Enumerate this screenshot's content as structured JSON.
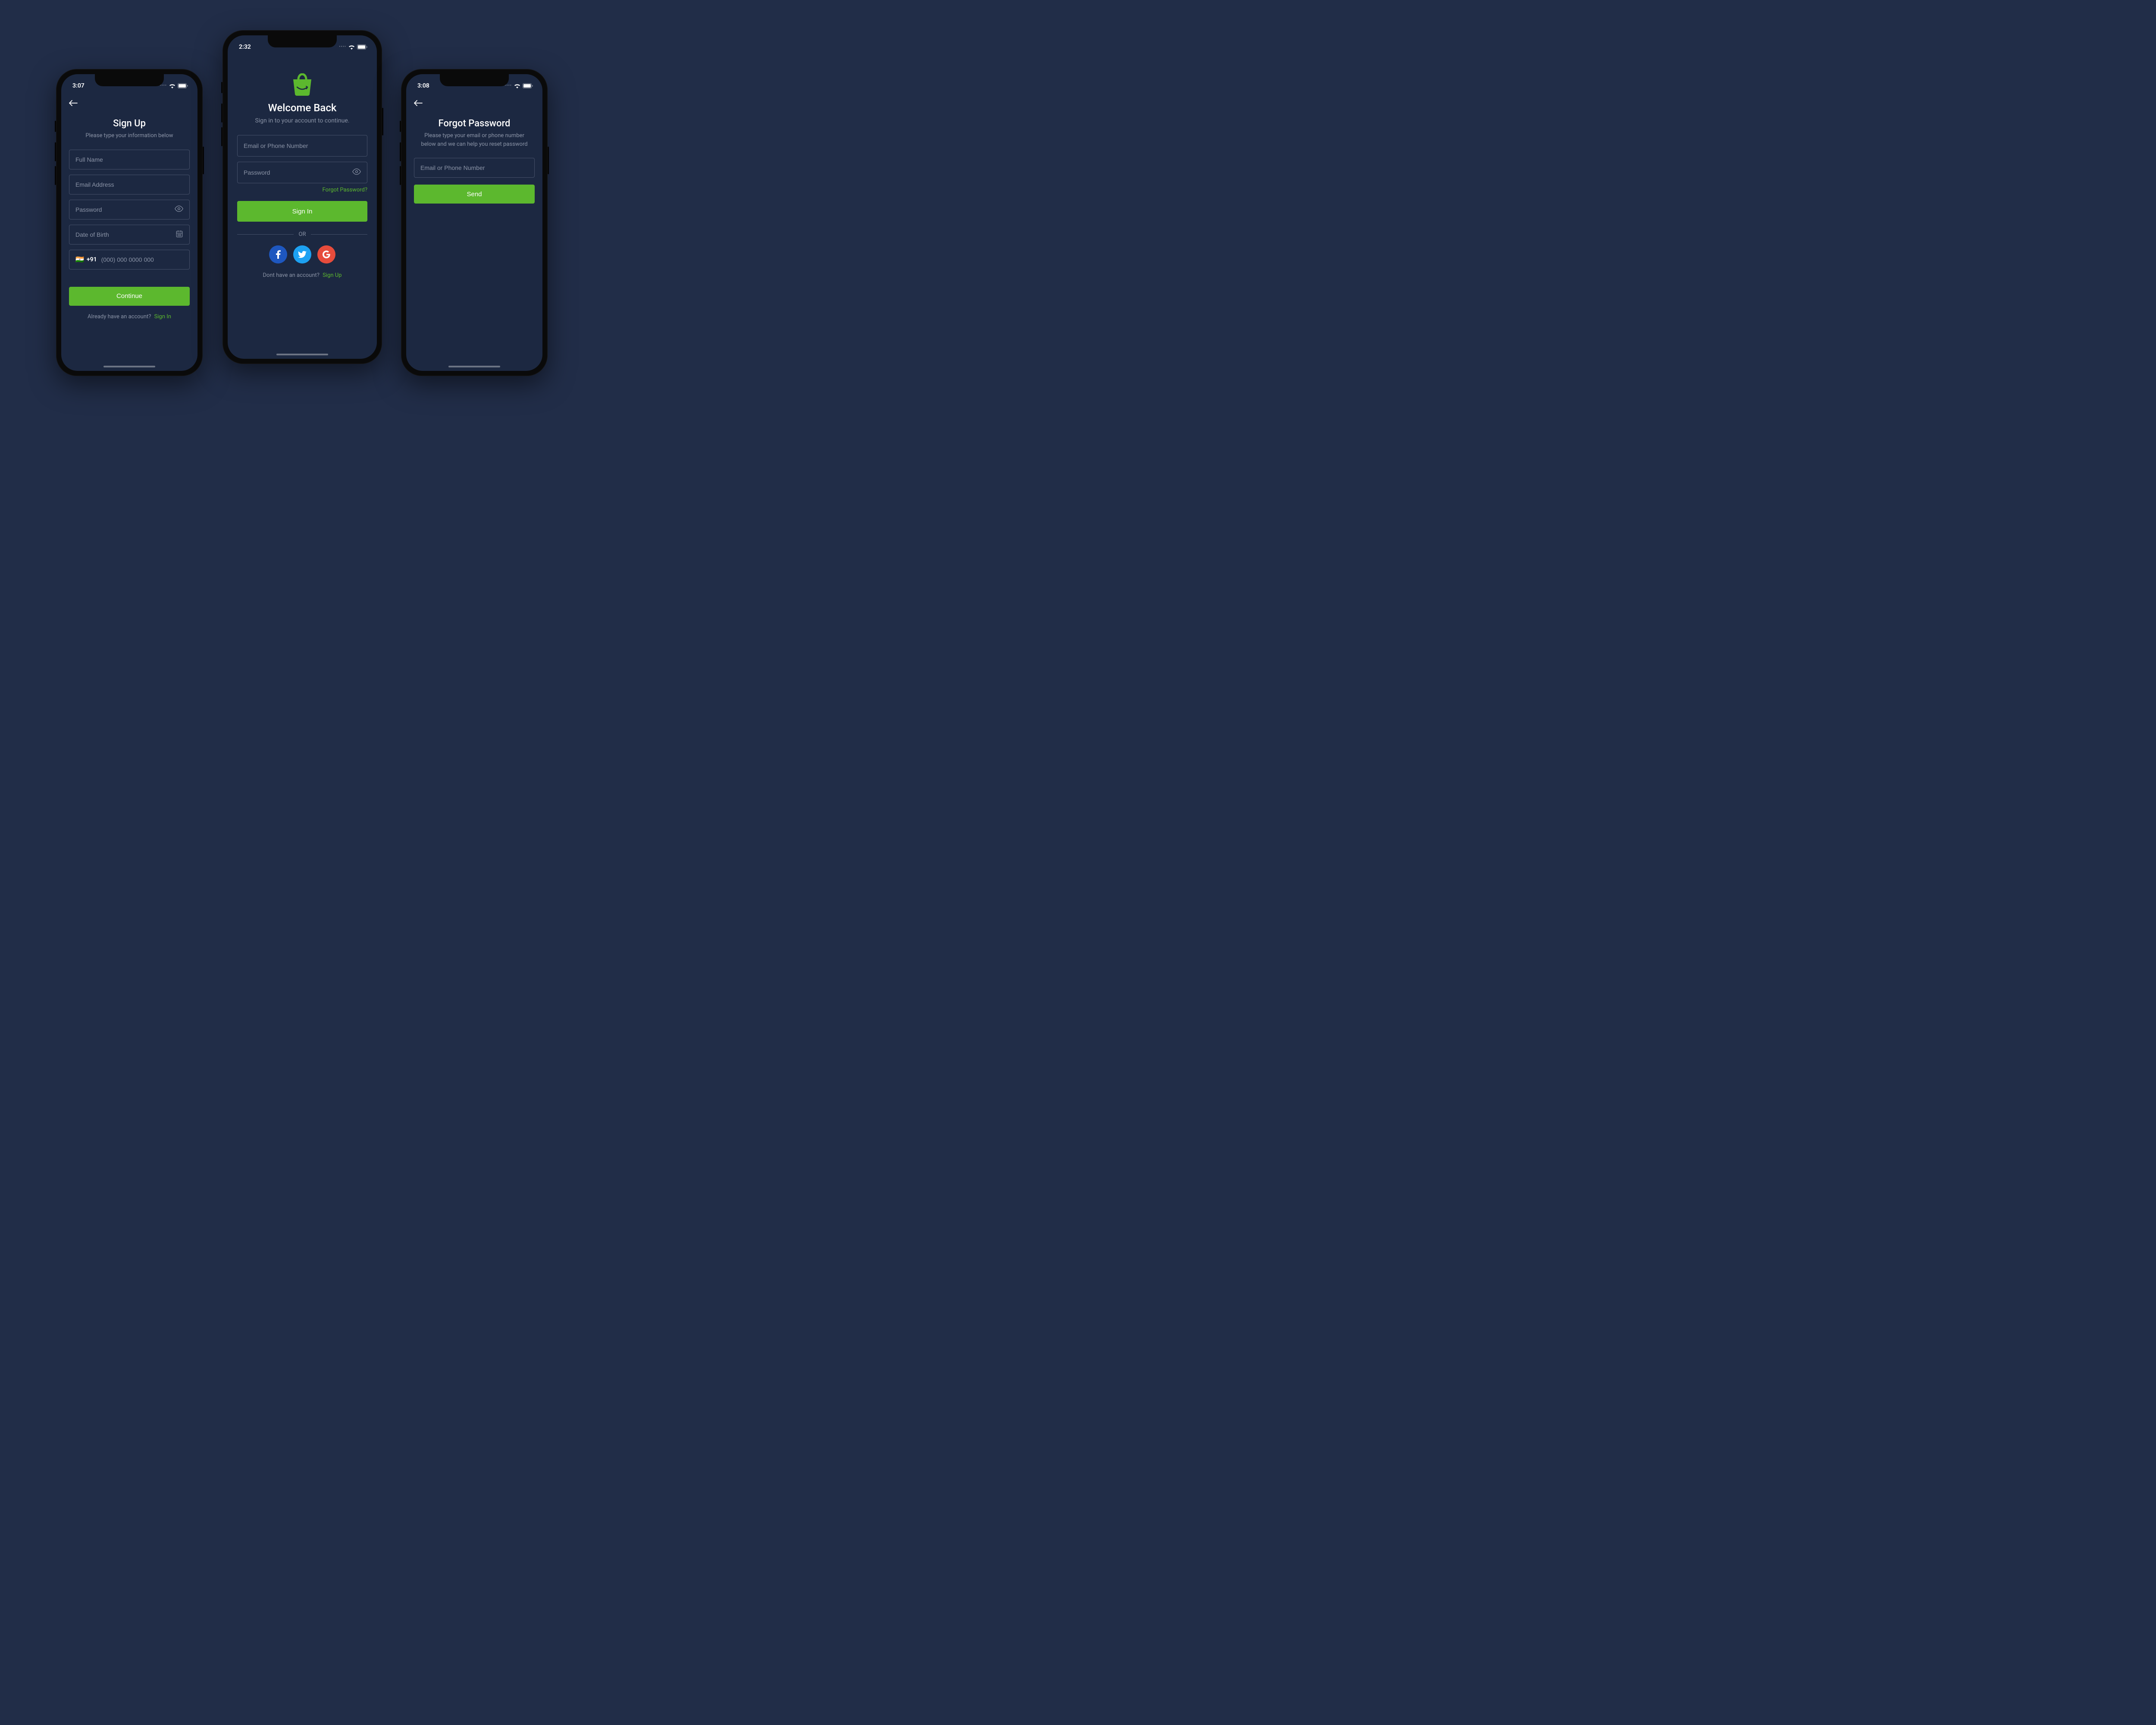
{
  "colors": {
    "accent": "#5CB82E",
    "bg": "#1C2841",
    "canvas": "#212D48"
  },
  "signup": {
    "time": "3:07",
    "title": "Sign Up",
    "subtitle": "Please type your information below",
    "fullname_placeholder": "Full Name",
    "email_placeholder": "Email Address",
    "password_placeholder": "Password",
    "dob_placeholder": "Date of Birth",
    "country_flag": "🇮🇳",
    "country_code": "+91",
    "phone_placeholder": "(000) 000 0000 000",
    "continue_label": "Continue",
    "already_text": "Already have an account?",
    "signin_link": "Sign In"
  },
  "signin": {
    "time": "2:32",
    "title": "Welcome Back",
    "subtitle": "Sign in to your account to continue.",
    "email_placeholder": "Email or Phone Number",
    "password_placeholder": "Password",
    "forgot_link": "Forgot Password?",
    "signin_label": "Sign In",
    "or_label": "OR",
    "dont_text": "Dont have an account?",
    "signup_link": "Sign Up"
  },
  "forgot": {
    "time": "3:08",
    "title": "Forgot Password",
    "subtitle": "Please type your email or phone number below and we can help you reset password",
    "email_placeholder": "Email or Phone Number",
    "send_label": "Send"
  }
}
